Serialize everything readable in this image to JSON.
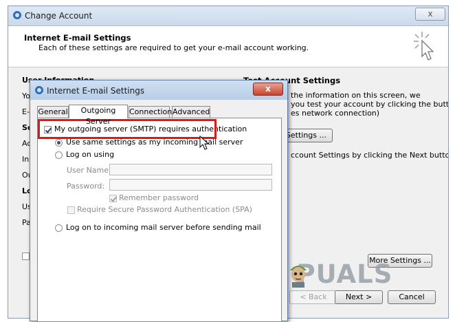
{
  "outer_window": {
    "title": "Change Account",
    "header_title": "Internet E-mail Settings",
    "header_subtitle": "Each of these settings are required to get your e-mail account working.",
    "close_label": "x",
    "left_labels": {
      "user_information": "User Information",
      "yo": "Yo",
      "e": "E-",
      "se": "Se",
      "ac": "Ac",
      "in": "In",
      "ou": "Ou",
      "lo": "Lo",
      "us": "Us",
      "pa": "Pa"
    },
    "test_account_settings": {
      "heading": "Test Account Settings",
      "line1": "the information on this screen, we",
      "line2": "you test your account by clicking the button",
      "line3": "es network connection)",
      "button_partial": "t Settings ...",
      "next_info": "ccount Settings by clicking the Next button"
    },
    "more_settings_label": "More Settings ...",
    "back_label": "< Back",
    "next_label": "Next >",
    "cancel_label": "Cancel"
  },
  "inner_dialog": {
    "title": "Internet E-mail Settings",
    "close_label": "x",
    "tabs": [
      {
        "label": "General",
        "active": false
      },
      {
        "label": "Outgoing Server",
        "active": true
      },
      {
        "label": "Connection",
        "active": false
      },
      {
        "label": "Advanced",
        "active": false
      }
    ],
    "smtp_auth_label": "My outgoing server (SMTP) requires authentication",
    "smtp_auth_checked": true,
    "use_same_label": "Use same settings as my incoming mail server",
    "log_on_using_label": "Log on using",
    "user_name_label": "User Name:",
    "user_name_value": "",
    "password_label": "Password:",
    "password_value": "",
    "remember_password_label": "Remember password",
    "remember_password_checked": true,
    "spa_label": "Require Secure Password Authentication (SPA)",
    "spa_checked": false,
    "log_on_incoming_label": "Log on to incoming mail server before sending mail"
  },
  "watermark": {
    "text": "A PUALS"
  },
  "colors": {
    "highlight": "#e21616",
    "title_bar": "#c9d9ec",
    "close_red": "#c8452e"
  }
}
